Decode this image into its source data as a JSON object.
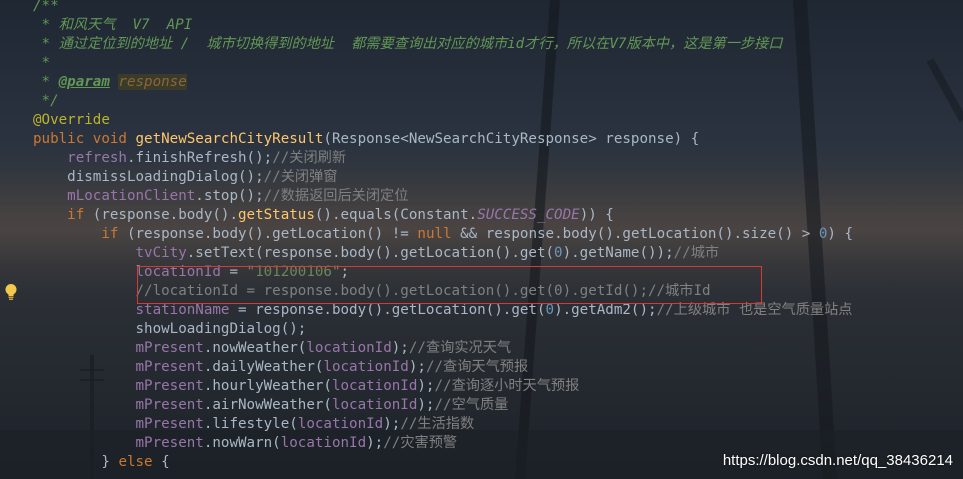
{
  "code": {
    "l1": "/**",
    "l2": " * 和风天气  V7  API",
    "l3": " * 通过定位到的地址 /  城市切换得到的地址  都需要查询出对应的城市id才行，所以在V7版本中，这是第一步接口",
    "l4": " *",
    "l5_prefix": " * ",
    "l5_tag": "@param",
    "l5_space": " ",
    "l5_name": "response",
    "l6": " */",
    "l7": "@Override",
    "l8": {
      "kw": "public void ",
      "fn": "getNewSearchCityResult",
      "rest": "(Response<NewSearchCityResponse> response) {"
    },
    "l9": {
      "indent": "    ",
      "fld": "refresh",
      "rest": ".finishRefresh();",
      "cm": "//关闭刷新"
    },
    "l10": {
      "indent": "    ",
      "rest": "dismissLoadingDialog();",
      "cm": "//关闭弹窗"
    },
    "l11": {
      "indent": "    ",
      "fld": "mLocationClient",
      "rest": ".stop();",
      "cm": "//数据返回后关闭定位"
    },
    "l12": {
      "indent": "    ",
      "kw": "if",
      "a": " (response.body().",
      "fn": "getStatus",
      "b": "().equals(Constant.",
      "cnst": "SUCCESS_CODE",
      "c": ")) {"
    },
    "l13": {
      "indent": "        ",
      "kw": "if",
      "a": " (response.body().getLocation() != ",
      "kw2": "null",
      "b": " && response.body().getLocation().size() > ",
      "num": "0",
      "c": ") {"
    },
    "l14": {
      "indent": "            ",
      "fld": "tvCity",
      "a": ".setText(response.body().getLocation().get(",
      "num": "0",
      "b": ").getName());",
      "cm": "//城市"
    },
    "l15": {
      "indent": "            ",
      "fld": "locationId",
      "a": " = ",
      "str": "\"101200106\"",
      "b": ";"
    },
    "l16": {
      "indent": "            ",
      "gcm": "//locationId = response.body().getLocation().get(0).getId();//城市Id"
    },
    "l17": {
      "indent": "            ",
      "fld": "stationName",
      "a": " = response.body().getLocation().get(",
      "num": "0",
      "b": ").getAdm2();",
      "cm": "//上级城市 也是空气质量站点"
    },
    "l18": {
      "indent": "            ",
      "rest": "showLoadingDialog();"
    },
    "l19": {
      "indent": "            ",
      "fld": "mPresent",
      "a": ".nowWeather(",
      "arg": "locationId",
      "b": ");",
      "cm": "//查询实况天气"
    },
    "l20": {
      "indent": "            ",
      "fld": "mPresent",
      "a": ".dailyWeather(",
      "arg": "locationId",
      "b": ");",
      "cm": "//查询天气预报"
    },
    "l21": {
      "indent": "            ",
      "fld": "mPresent",
      "a": ".hourlyWeather(",
      "arg": "locationId",
      "b": ");",
      "cm": "//查询逐小时天气预报"
    },
    "l22": {
      "indent": "            ",
      "fld": "mPresent",
      "a": ".airNowWeather(",
      "arg": "locationId",
      "b": ");",
      "cm": "//空气质量"
    },
    "l23": {
      "indent": "            ",
      "fld": "mPresent",
      "a": ".lifestyle(",
      "arg": "locationId",
      "b": ");",
      "cm": "//生活指数"
    },
    "l24": {
      "indent": "            ",
      "fld": "mPresent",
      "a": ".nowWarn(",
      "arg": "locationId",
      "b": ");",
      "cm": "//灾害预警"
    },
    "l25": {
      "indent": "        ",
      "a": "} ",
      "kw": "else",
      "b": " {"
    }
  },
  "watermark": "https://blog.csdn.net/qq_38436214",
  "icons": {
    "intention": "lightbulb-icon"
  },
  "colors": {
    "highlight_border": "#d53b35"
  }
}
